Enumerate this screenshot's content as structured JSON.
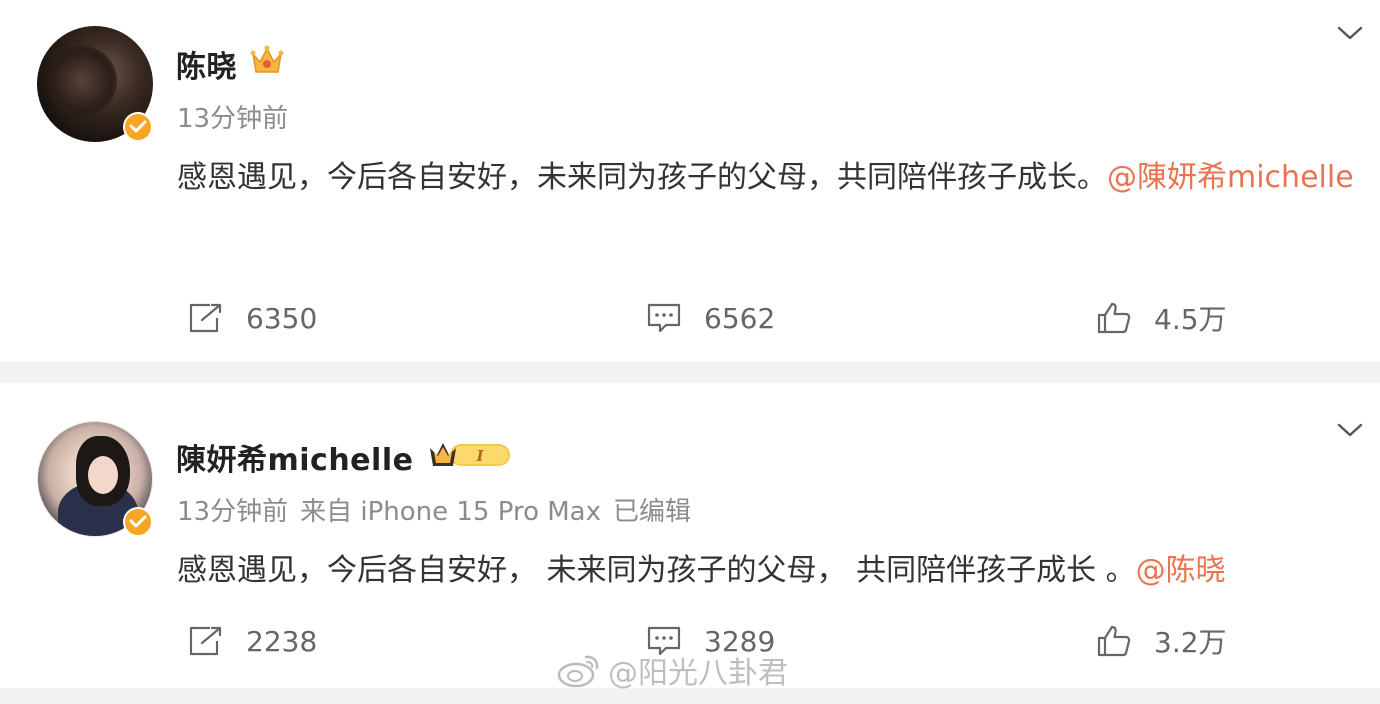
{
  "posts": [
    {
      "username": "陈晓",
      "time": "13分钟前",
      "source": "",
      "edited": "",
      "content_text": "感恩遇见，今后各自安好，未来同为孩子的父母，共同陪伴孩子成长。",
      "mention": "@陳妍希michelle",
      "actions": {
        "repost": "6350",
        "comment": "6562",
        "like": "4.5万"
      }
    },
    {
      "username": "陳妍希michelle",
      "time": "13分钟前",
      "source": "来自 iPhone 15 Pro Max",
      "edited": "已编辑",
      "content_text": "感恩遇见，今后各自安好， 未来同为孩子的父母， 共同陪伴孩子成长 。",
      "mention": "@陈晓",
      "actions": {
        "repost": "2238",
        "comment": "3289",
        "like": "3.2万"
      }
    }
  ],
  "badge_level": "I",
  "watermark": "@阳光八卦君",
  "colors": {
    "mention": "#eb7350",
    "verified_badge": "#f6a623",
    "meta_text": "#8c8c8c",
    "page_gap": "#f2f2f2"
  },
  "icons": [
    "chevron-down-icon",
    "crown-icon",
    "verified-icon",
    "repost-icon",
    "comment-icon",
    "like-icon",
    "weibo-logo-icon"
  ]
}
